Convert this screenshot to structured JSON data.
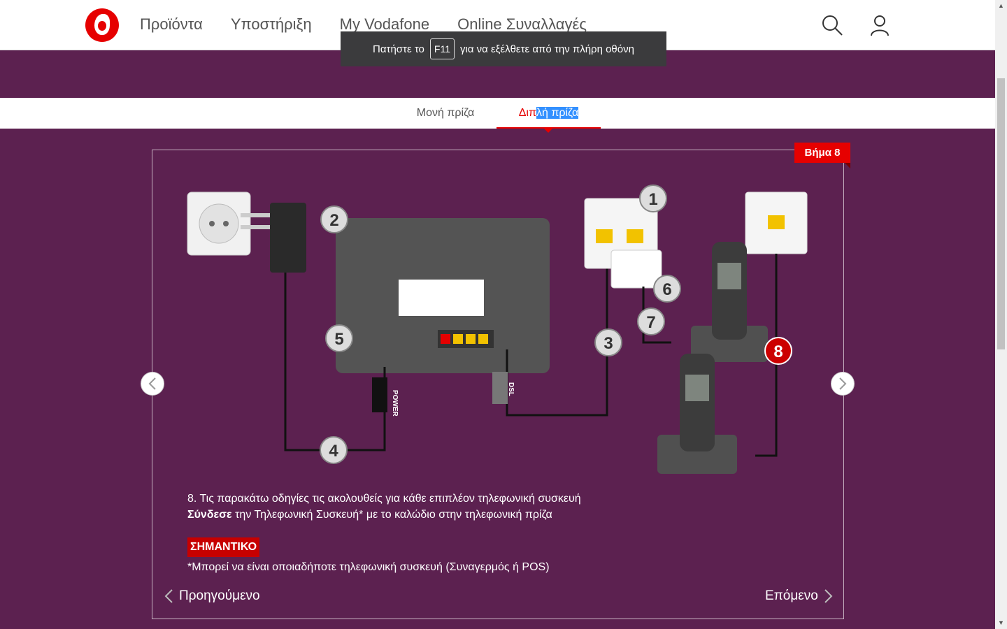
{
  "header": {
    "nav": [
      "Προϊόντα",
      "Υποστήριξη",
      "My Vodafone",
      "Online Συναλλαγές"
    ],
    "icons": [
      "search-icon",
      "user-icon"
    ]
  },
  "toast": {
    "before": "Πατήστε το",
    "key": "F11",
    "after": "για να εξέλθετε από την πλήρη οθόνη"
  },
  "tabs": {
    "single": "Μονή πρίζα",
    "double_pre": "Διπ",
    "double_sel": "λή πρίζα"
  },
  "step": {
    "badge": "Βήμα 8"
  },
  "diagram": {
    "numbers": [
      "1",
      "2",
      "3",
      "4",
      "5",
      "6",
      "7",
      "8"
    ],
    "power_label": "POWER",
    "dsl_label": "DSL"
  },
  "content": {
    "line1": "8. Τις παρακάτω οδηγίες τις ακολουθείς για κάθε επιπλέον τηλεφωνική συσκευή",
    "line2_bold": "Σύνδεσε",
    "line2_rest": " την Τηλεφωνική Συσκευή* με το καλώδιο στην τηλεφωνική πρίζα",
    "important": "ΣΗΜΑΝΤΙΚΟ",
    "note": "*Μπορεί να είναι οποιαδήποτε τηλεφωνική συσκευή (Συναγερμός ή POS)"
  },
  "pager": {
    "prev": "Προηγούμενο",
    "next": "Επόμενο"
  },
  "colors": {
    "brand": "#e60000",
    "background": "#5c2150"
  }
}
